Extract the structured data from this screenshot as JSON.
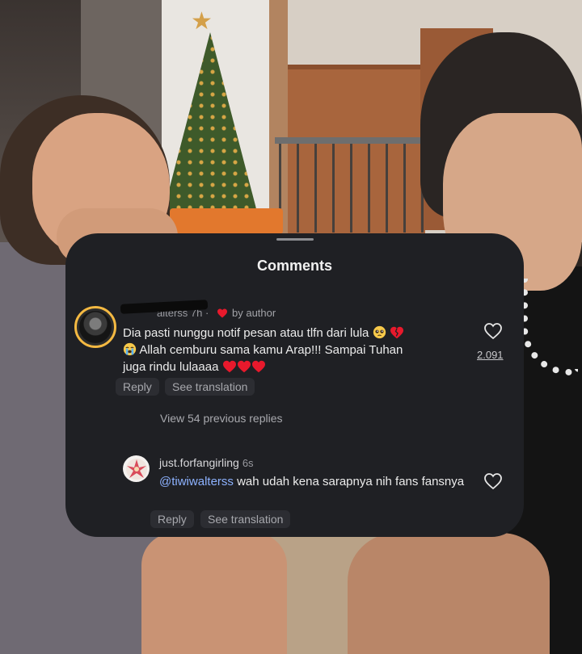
{
  "sheet": {
    "title": "Comments"
  },
  "comments": [
    {
      "username": "tiwiwalterss",
      "username_visible": "alterss",
      "time": "7h",
      "by_author_label": "by author",
      "text_line1": "Dia pasti nunggu notif pesan atau tlfn dari lula",
      "text_line2": " Allah cemburu sama kamu Arap!!! Sampai Tuhan",
      "text_line3": "juga rindu lulaaaa",
      "likes": "2.091",
      "reply_label": "Reply",
      "translation_label": "See translation",
      "avatar_story_ring_color": "#f4b942"
    }
  ],
  "view_previous_replies": "View 54 previous replies",
  "replies": [
    {
      "username": "just.forfangirling",
      "time": "6s",
      "mention": "@tiwiwalterss",
      "text": " wah udah kena sarapnya nih fans fansnya",
      "reply_label": "Reply",
      "translation_label": "See translation"
    }
  ],
  "icons": {
    "author_heart": "red-heart-icon",
    "like": "heart-outline-icon",
    "emoji_pleading": "pleading-face-emoji",
    "emoji_broken_heart": "broken-heart-emoji",
    "emoji_crying": "loudly-crying-face-emoji",
    "emoji_red_heart": "red-heart-emoji"
  },
  "colors": {
    "sheet_bg": "#1f2024",
    "mention": "#8db2ff",
    "heart": "#e8192c"
  }
}
